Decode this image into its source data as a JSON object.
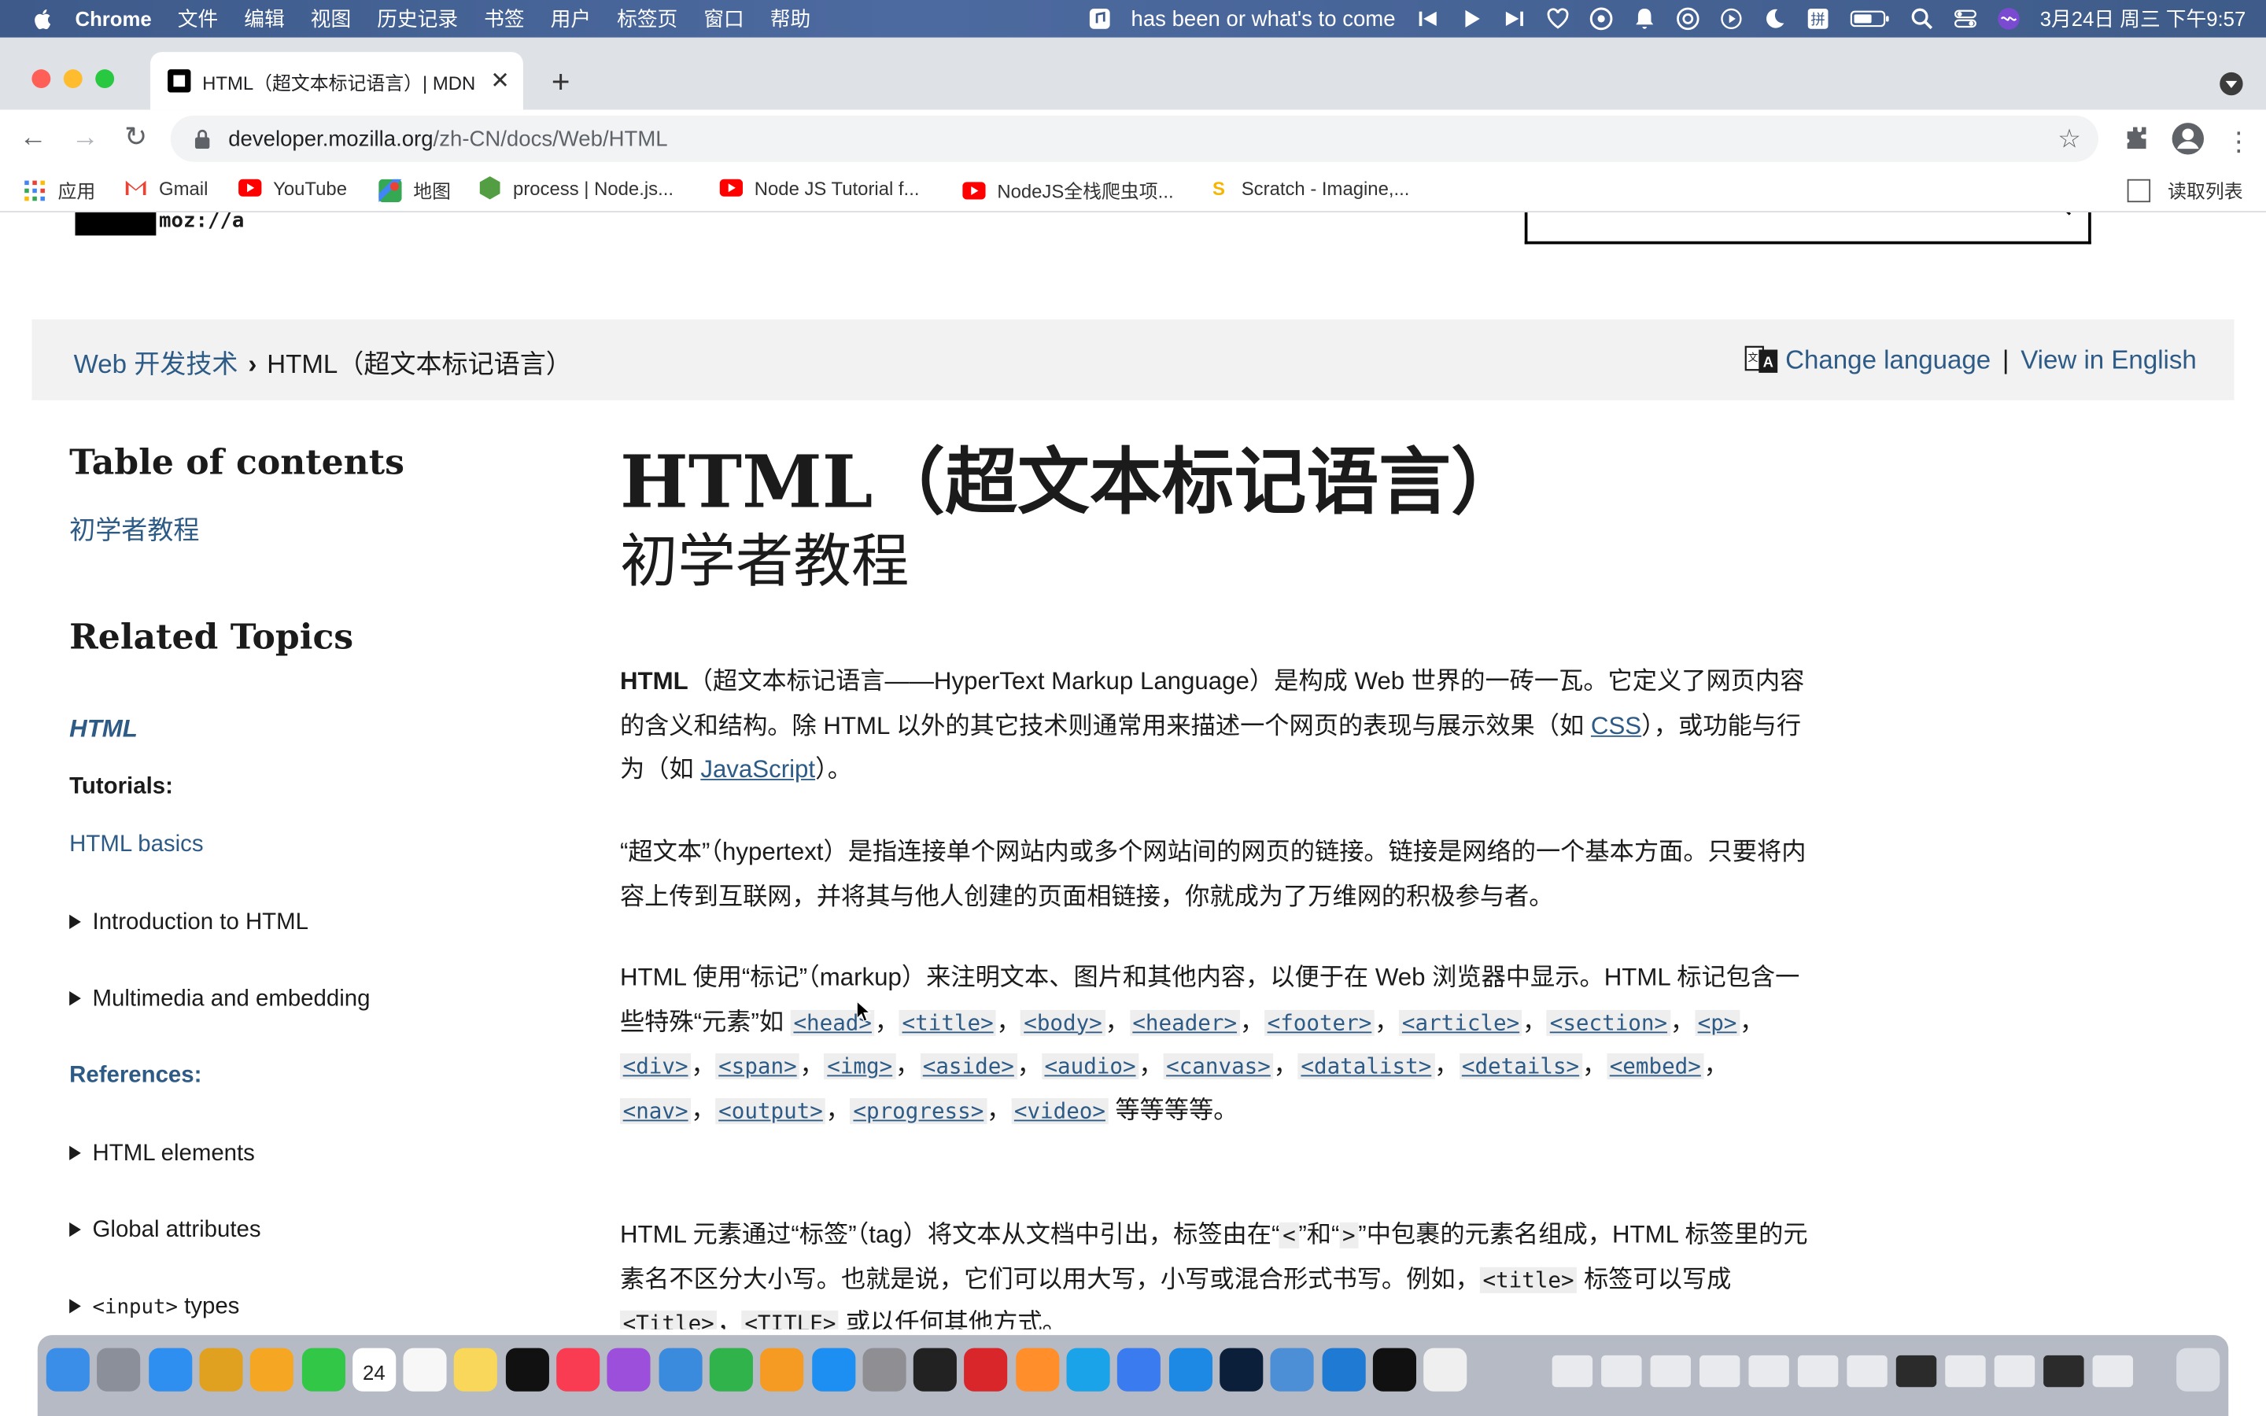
{
  "menubar": {
    "app": "Chrome",
    "items": [
      "文件",
      "编辑",
      "视图",
      "历史记录",
      "书签",
      "用户",
      "标签页",
      "窗口",
      "帮助"
    ],
    "now_playing": "has been or what's to come",
    "datetime": "3月24日 周三 下午9:57"
  },
  "tab": {
    "title": "HTML（超文本标记语言）| MDN"
  },
  "omnibox": {
    "host": "developer.mozilla.org",
    "path": "/zh-CN/docs/Web/HTML"
  },
  "bookmarks": {
    "items": [
      {
        "label": "应用",
        "color": "#4285f4"
      },
      {
        "label": "Gmail",
        "color": "#ea4335"
      },
      {
        "label": "YouTube",
        "color": "#ff0000"
      },
      {
        "label": "地图",
        "color": "#34a853"
      },
      {
        "label": "process | Node.js...",
        "color": "#539e43"
      },
      {
        "label": "Node JS Tutorial f...",
        "color": "#ff0000"
      },
      {
        "label": "NodeJS全栈爬虫项...",
        "color": "#ff0000"
      },
      {
        "label": "Scratch - Imagine,...",
        "color": "#f7b500"
      }
    ],
    "reading_list": "读取列表"
  },
  "page": {
    "logo_text": "moz://a",
    "breadcrumb": {
      "parent": "Web 开发技术",
      "separator": "›",
      "current": "HTML（超文本标记语言）"
    },
    "change_language": "Change language",
    "lang_sep": "|",
    "view_in_english": "View in English",
    "toc_title": "Table of contents",
    "toc_link": "初学者教程",
    "related_title": "Related Topics",
    "related_html": "HTML",
    "tutorials_label": "Tutorials:",
    "html_basics": "HTML basics",
    "intro_html": "Introduction to HTML",
    "multimedia": "Multimedia and embedding",
    "references_label": "References:",
    "html_elements": "HTML elements",
    "global_attrs": "Global attributes",
    "input_code": "<input>",
    "input_types": " types",
    "h1": "HTML（超文本标记语言）",
    "h1_sub": "初学者教程",
    "p1": {
      "bold": "HTML",
      "a": "（超文本标记语言——HyperText Markup Language）是构成 Web 世界的一砖一瓦。它定义了网页内容的含义和结构。除 HTML 以外的其它技术则通常用来描述一个网页的表现与展示效果（如 ",
      "css": "CSS",
      "b": "），或功能与行为（如 ",
      "js": "JavaScript",
      "c": "）。"
    },
    "p2": "“超文本”（hypertext）是指连接单个网站内或多个网站间的网页的链接。链接是网络的一个基本方面。只要将内容上传到互联网，并将其与他人创建的页面相链接，你就成为了万维网的积极参与者。",
    "p3": {
      "intro": "HTML 使用“标记”（markup）来注明文本、图片和其他内容，以便于在 Web 浏览器中显示。HTML 标记包含一些特殊“元素”如 ",
      "tags": [
        "<head>",
        "<title>",
        "<body>",
        "<header>",
        "<footer>",
        "<article>",
        "<section>",
        "<p>",
        "<div>",
        "<span>",
        "<img>",
        "<aside>",
        "<audio>",
        "<canvas>",
        "<datalist>",
        "<details>",
        "<embed>",
        "<nav>",
        "<output>",
        "<progress>",
        "<video>"
      ],
      "sep": "，",
      "outro": " 等等等等。"
    },
    "p4": {
      "a": "HTML 元素通过“标签”（tag）将文本从文档中引出，标签由在“",
      "lt": "<",
      "b": "”和“",
      "gt": ">",
      "c": "”中包裹的元素名组成，HTML 标签里的元素名不区分大小写。也就是说，它们可以用大写，小写或混合形式书写。例如，",
      "t1": "<title>",
      "d": " 标签可以写成 ",
      "t2": "<Title>",
      "e": "，",
      "t3": "<TITLE>",
      "f": " 或以任何其他方式。"
    }
  },
  "dock": {
    "apps": [
      {
        "name": "finder",
        "color": "#3b8ee8"
      },
      {
        "name": "launchpad",
        "color": "#8a8f99"
      },
      {
        "name": "safari",
        "color": "#2f8ff0"
      },
      {
        "name": "chrome",
        "color": "#e0a020"
      },
      {
        "name": "photos",
        "color": "#f5a623"
      },
      {
        "name": "facetime",
        "color": "#33c748"
      },
      {
        "name": "calendar",
        "color": "#ffffff"
      },
      {
        "name": "reminders",
        "color": "#f7f7f7"
      },
      {
        "name": "notes",
        "color": "#f8d75a"
      },
      {
        "name": "apple-tv",
        "color": "#111111"
      },
      {
        "name": "music",
        "color": "#fa3c52"
      },
      {
        "name": "podcasts",
        "color": "#9b4fdb"
      },
      {
        "name": "keynote",
        "color": "#3a8bde"
      },
      {
        "name": "numbers",
        "color": "#2fb34a"
      },
      {
        "name": "pages",
        "color": "#f59a23"
      },
      {
        "name": "app-store",
        "color": "#1d8ff2"
      },
      {
        "name": "system-preferences",
        "color": "#8e8e93"
      },
      {
        "name": "terminal",
        "color": "#222222"
      },
      {
        "name": "netease-music",
        "color": "#d8262b"
      },
      {
        "name": "sublime-text",
        "color": "#ff8e2b"
      },
      {
        "name": "webstorm",
        "color": "#1aa3e8"
      },
      {
        "name": "feishu",
        "color": "#3a7cf0"
      },
      {
        "name": "xcode",
        "color": "#1e88e5"
      },
      {
        "name": "photoshop",
        "color": "#0b1f3a"
      },
      {
        "name": "quicktime",
        "color": "#4c8fd6"
      },
      {
        "name": "vscode",
        "color": "#1f7ad4"
      },
      {
        "name": "qq",
        "color": "#111111"
      },
      {
        "name": "textedit",
        "color": "#efefef"
      }
    ],
    "calendar_day": "24"
  }
}
